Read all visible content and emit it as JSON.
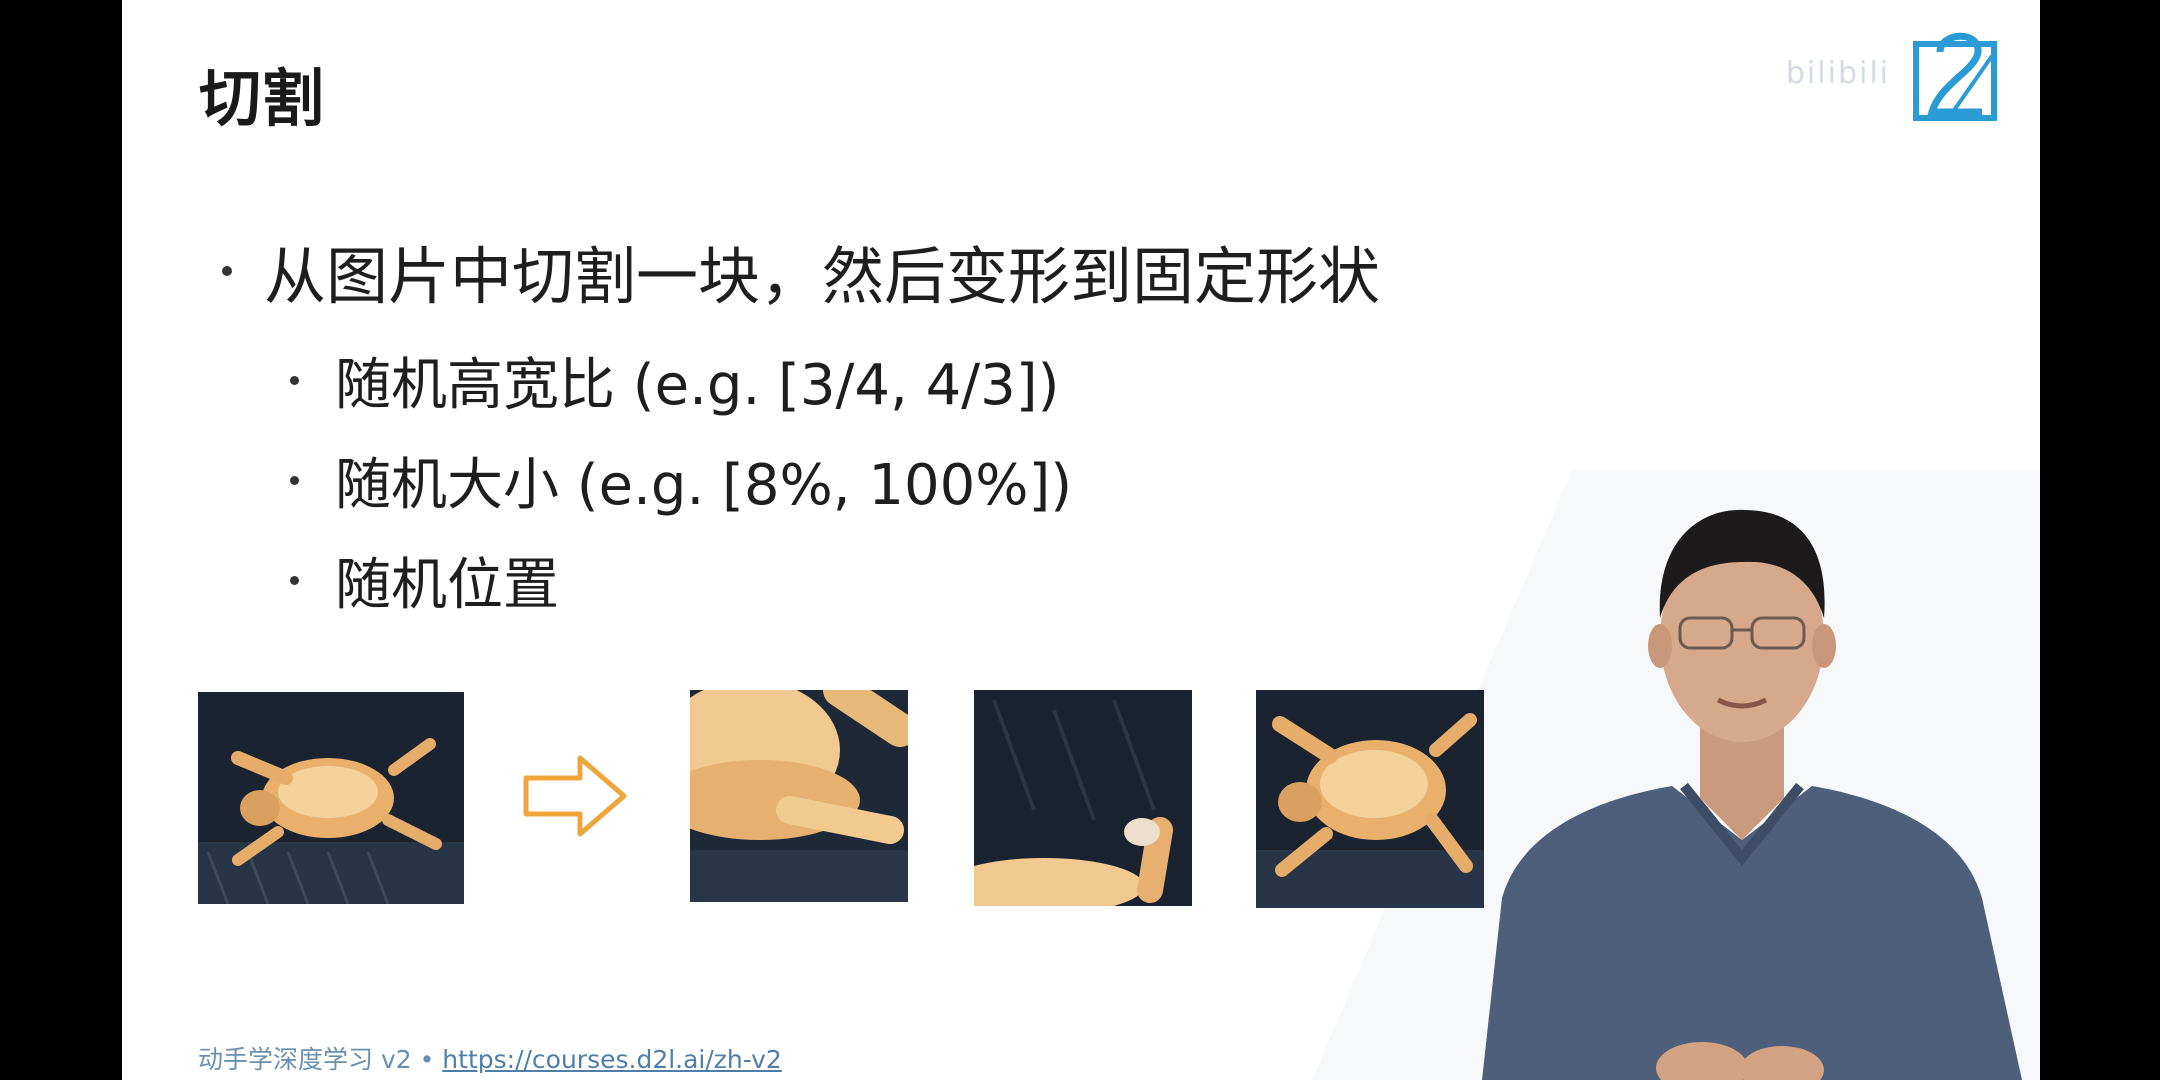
{
  "slide": {
    "title": "切割",
    "main_bullet": "从图片中切割一块，然后变形到固定形状",
    "sub_bullets": [
      "随机高宽比 (e.g. [3/4, 4/3])",
      "随机大小 (e.g. [8%, 100%])",
      "随机位置"
    ],
    "footer_prefix": "动手学深度学习 v2 • ",
    "footer_link": "https://courses.d2l.ai/zh-v2"
  },
  "watermark": {
    "text": "bilibili"
  },
  "icons": {
    "arrow": "right-arrow-outline-icon",
    "logo": "d2l-logo-icon"
  },
  "colors": {
    "arrow": "#f0a53c",
    "logo": "#2b9bd6",
    "footer_text": "#6a8faf",
    "link": "#4f7fa8"
  },
  "images": [
    {
      "name": "original-cat-image"
    },
    {
      "name": "crop-1-image"
    },
    {
      "name": "crop-2-image"
    },
    {
      "name": "crop-3-image"
    }
  ]
}
